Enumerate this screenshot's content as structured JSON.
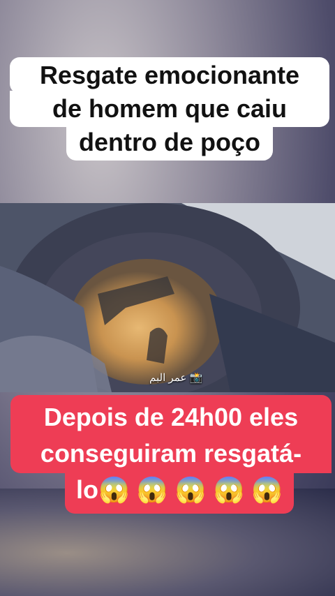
{
  "top_caption": {
    "line1": "Resgate emocionante",
    "line2": "de homem  que caiu",
    "line3": "dentro de poço"
  },
  "video": {
    "watermark": "عمر البم 📸"
  },
  "bottom_caption": {
    "line1": "Depois de 24h00 eles",
    "line2": "conseguiram resgatá-",
    "line3": "lo😱 😱 😱 😱 😱"
  },
  "colors": {
    "caption_bg": "#ffffff",
    "highlight_bg": "#ee3d55"
  }
}
